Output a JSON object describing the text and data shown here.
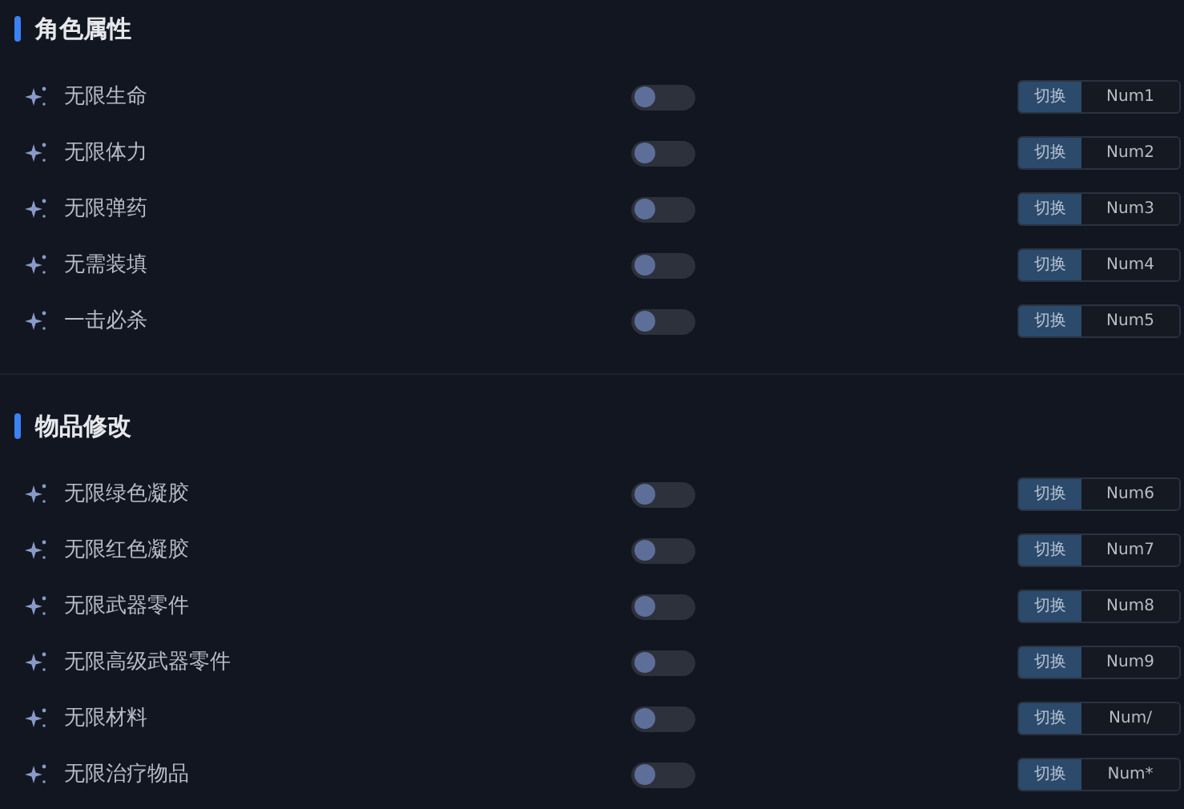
{
  "sections": [
    {
      "title": "角色属性",
      "items": [
        {
          "label": "无限生命",
          "on": false,
          "action": "切换",
          "key": "Num1"
        },
        {
          "label": "无限体力",
          "on": false,
          "action": "切换",
          "key": "Num2"
        },
        {
          "label": "无限弹药",
          "on": false,
          "action": "切换",
          "key": "Num3"
        },
        {
          "label": "无需装填",
          "on": false,
          "action": "切换",
          "key": "Num4"
        },
        {
          "label": "一击必杀",
          "on": false,
          "action": "切换",
          "key": "Num5"
        }
      ]
    },
    {
      "title": "物品修改",
      "items": [
        {
          "label": "无限绿色凝胶",
          "on": false,
          "action": "切换",
          "key": "Num6"
        },
        {
          "label": "无限红色凝胶",
          "on": false,
          "action": "切换",
          "key": "Num7"
        },
        {
          "label": "无限武器零件",
          "on": false,
          "action": "切换",
          "key": "Num8"
        },
        {
          "label": "无限高级武器零件",
          "on": false,
          "action": "切换",
          "key": "Num9"
        },
        {
          "label": "无限材料",
          "on": false,
          "action": "切换",
          "key": "Num/"
        },
        {
          "label": "无限治疗物品",
          "on": false,
          "action": "切换",
          "key": "Num*"
        }
      ]
    }
  ]
}
